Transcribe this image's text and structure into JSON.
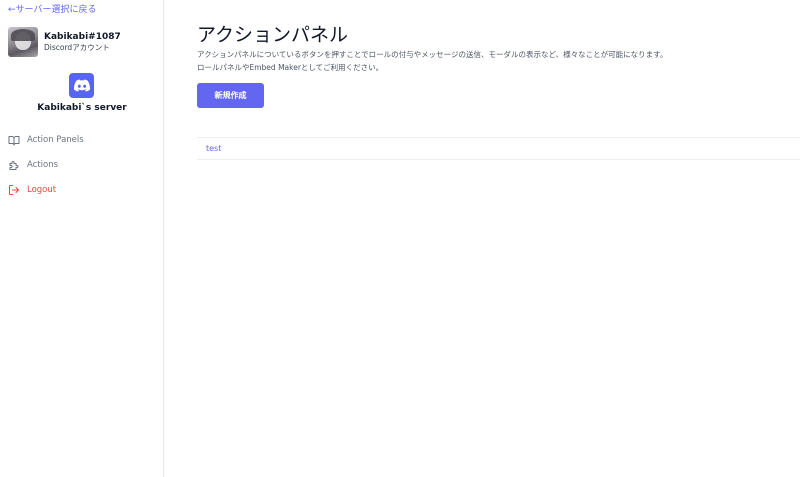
{
  "sidebar": {
    "back_link": "←サーバー選択に戻る",
    "user": {
      "name": "Kabikabi#1087",
      "subtitle": "Discordアカウント"
    },
    "server": {
      "name": "Kabikabi`s server",
      "icon": "discord-icon",
      "icon_color": "#5865f2"
    },
    "nav": [
      {
        "label": "Action Panels",
        "icon": "book-icon"
      },
      {
        "label": "Actions",
        "icon": "puzzle-icon"
      },
      {
        "label": "Logout",
        "icon": "logout-icon",
        "color": "#ef4444"
      }
    ]
  },
  "main": {
    "title": "アクションパネル",
    "description_line1": "アクションパネルについているボタンを押すことでロールの付与やメッセージの送信、モーダルの表示など、様々なことが可能になります。",
    "description_line2": "ロールパネルやEmbed Makerとしてご利用ください。",
    "new_button_label": "新規作成",
    "panels": [
      {
        "label": "test"
      }
    ]
  },
  "colors": {
    "accent": "#6366f1",
    "logout": "#ef4444"
  }
}
